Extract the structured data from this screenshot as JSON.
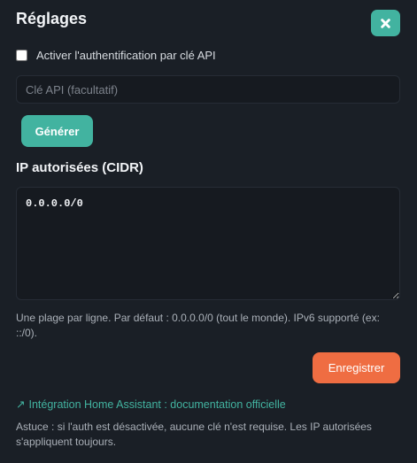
{
  "panel": {
    "title": "Réglages",
    "close_icon": "close-icon"
  },
  "auth": {
    "checkbox_label": "Activer l'authentification par clé API",
    "checked": false,
    "api_key_placeholder": "Clé API (facultatif)",
    "api_key_value": "",
    "generate_label": "Générer"
  },
  "cidr": {
    "title": "IP autorisées (CIDR)",
    "value": "0.0.0.0/0",
    "hint": "Une plage par ligne. Par défaut : 0.0.0.0/0 (tout le monde). IPv6 supporté (ex: ::/0)."
  },
  "actions": {
    "save_label": "Enregistrer"
  },
  "footer": {
    "link_arrow": "↗",
    "link_label": "Intégration Home Assistant : documentation officielle",
    "tip": "Astuce : si l'auth est désactivée, aucune clé n'est requise. Les IP autorisées s'appliquent toujours."
  },
  "colors": {
    "background": "#1a1f26",
    "accent": "#42b3a0",
    "save": "#ef6d42"
  }
}
